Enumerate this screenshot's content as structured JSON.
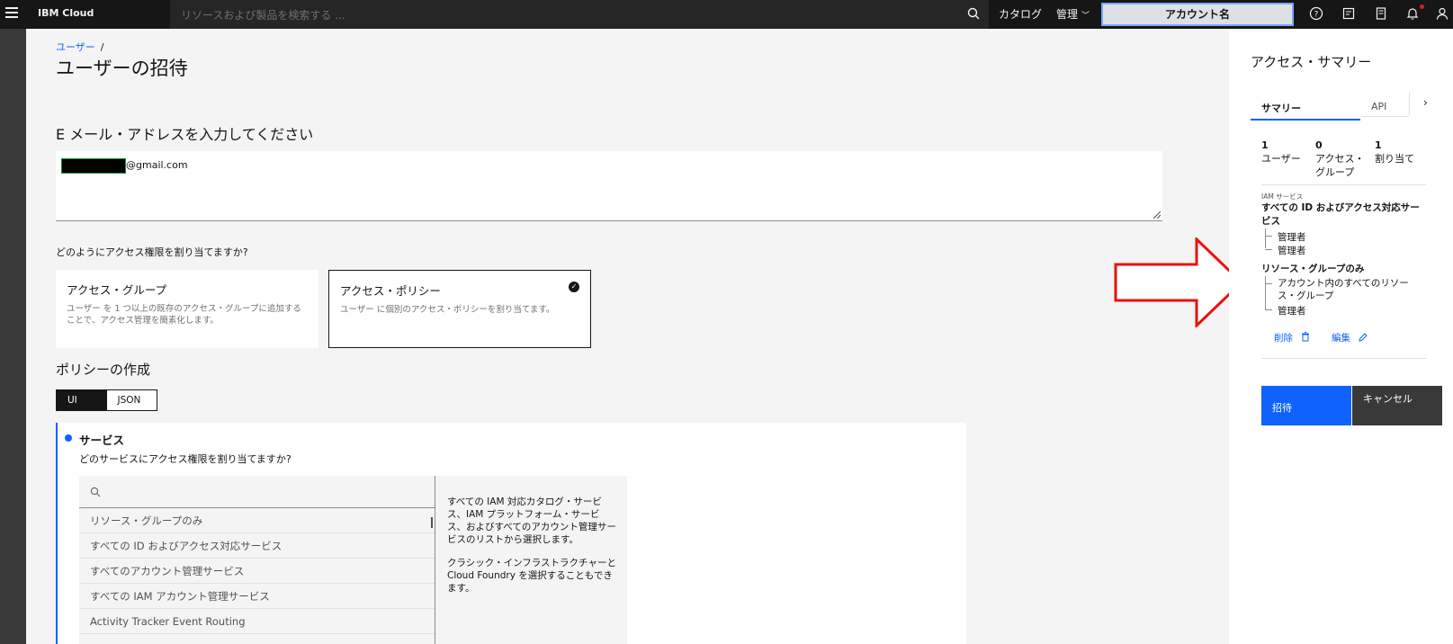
{
  "header": {
    "brand": "IBM Cloud",
    "search_placeholder": "リソースおよび製品を検索する ...",
    "catalog": "カタログ",
    "manage": "管理",
    "account": "アカウント名"
  },
  "breadcrumb": {
    "parent": "ユーザー",
    "separator": "/"
  },
  "page_title": "ユーザーの招待",
  "email": {
    "heading": "E メール・アドレスを入力してください",
    "value": "@gmail.com"
  },
  "assign_question": "どのようにアクセス権限を割り当てますか?",
  "tiles": [
    {
      "title": "アクセス・グループ",
      "desc": "ユーザー を 1 つ以上の既存のアクセス・グループに追加することで、アクセス管理を簡素化します。",
      "selected": false
    },
    {
      "title": "アクセス・ポリシー",
      "desc": "ユーザー に個別のアクセス・ポリシーを割り当てます。",
      "selected": true
    }
  ],
  "policy": {
    "title": "ポリシーの作成",
    "toggle": [
      "UI",
      "JSON"
    ],
    "active_toggle": "UI"
  },
  "service": {
    "title": "サービス",
    "question": "どのサービスにアクセス権限を割り当てますか?",
    "items": [
      "リソース・グループのみ",
      "すべての ID およびアクセス対応サービス",
      "すべてのアカウント管理サービス",
      "すべての IAM アカウント管理サービス",
      "Activity Tracker Event Routing"
    ],
    "desc1": "すべての IAM 対応カタログ・サービス、IAM プラットフォーム・サービス、およびすべてのアカウント管理サービスのリストから選択します。",
    "desc2": "クラシック・インフラストラクチャーと Cloud Foundry を選択することもできます。"
  },
  "summary": {
    "title": "アクセス・サマリー",
    "tabs": [
      "サマリー",
      "API"
    ],
    "stats": [
      {
        "num": "1",
        "label": "ユーザー"
      },
      {
        "num": "0",
        "label": "アクセス・グループ"
      },
      {
        "num": "1",
        "label": "割り当て"
      }
    ],
    "iam_label": "IAM サービス",
    "iam_title": "すべての ID およびアクセス対応サービス",
    "roles": [
      "管理者",
      "管理者"
    ],
    "rg_title": "リソース・グループのみ",
    "rg_scope": "アカウント内のすべてのリソース・グループ",
    "rg_role": "管理者",
    "delete": "削除",
    "edit": "編集",
    "invite": "招待",
    "cancel": "キャンセル"
  },
  "colors": {
    "primary": "#0f62fe",
    "header_bg": "#161616",
    "annotation": "#e8120f"
  }
}
